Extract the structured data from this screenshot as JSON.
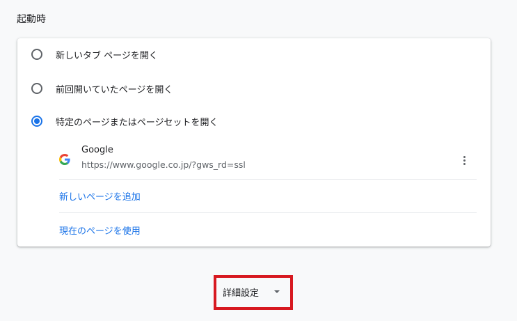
{
  "section": {
    "title": "起動時"
  },
  "startup_options": [
    {
      "label": "新しいタブ ページを開く",
      "selected": false
    },
    {
      "label": "前回開いていたページを開く",
      "selected": false
    },
    {
      "label": "特定のページまたはページセットを開く",
      "selected": true
    }
  ],
  "pages": [
    {
      "name": "Google",
      "url": "https://www.google.co.jp/?gws_rd=ssl",
      "icon": "google-favicon-icon"
    }
  ],
  "actions": {
    "add_page": "新しいページを追加",
    "use_current": "現在のページを使用"
  },
  "advanced": {
    "label": "詳細設定",
    "icon": "chevron-down-icon",
    "highlight_color": "#d71920"
  },
  "colors": {
    "accent": "#1a73e8",
    "text": "#202124",
    "secondary_text": "#5f6368"
  }
}
